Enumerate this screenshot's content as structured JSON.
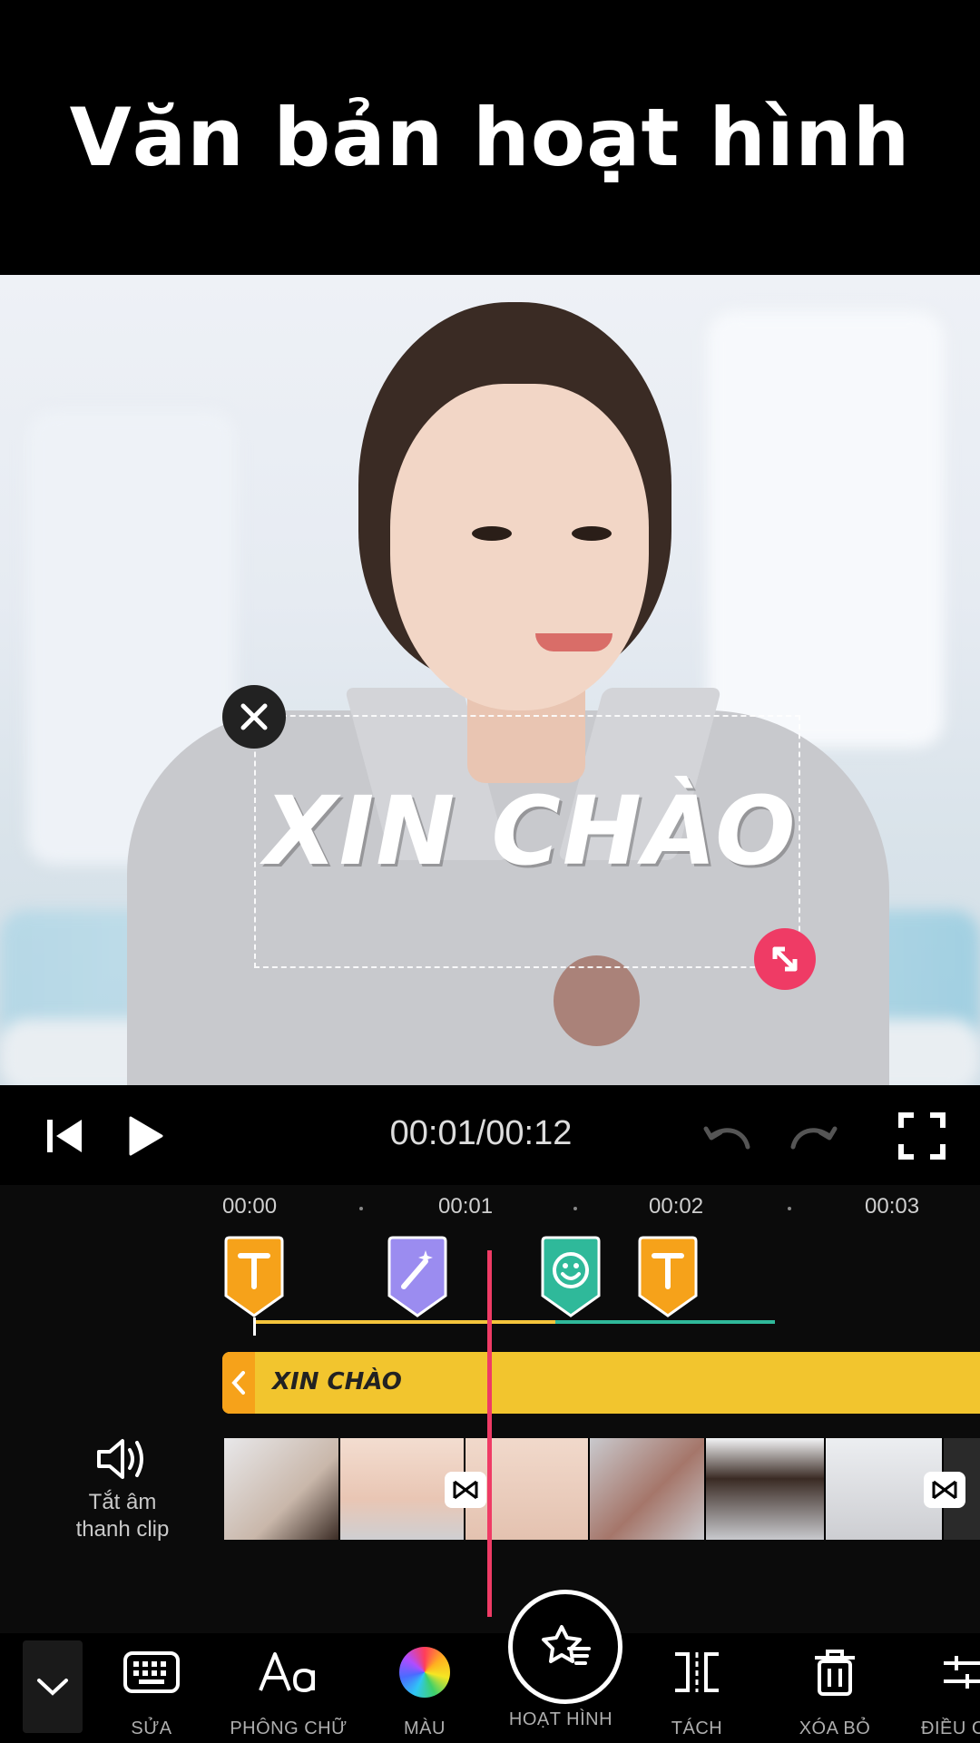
{
  "banner": {
    "title": "Văn bản hoạt hình"
  },
  "preview": {
    "overlay_text": "XIN CHÀO"
  },
  "player": {
    "time": "00:01/00:12"
  },
  "timeline": {
    "ticks": [
      "00:00",
      "00:01",
      "00:02",
      "00:03"
    ],
    "markers": [
      {
        "icon": "text-icon",
        "color": "#f6a21a",
        "letter": "T"
      },
      {
        "icon": "magic-wand-icon",
        "color": "#9b8cf0"
      },
      {
        "icon": "smiley-icon",
        "color": "#2fb99a"
      },
      {
        "icon": "text-icon",
        "color": "#f6a21a",
        "letter": "T"
      }
    ],
    "text_clip_label": "XIN CHÀO",
    "mute": {
      "line1": "Tắt âm",
      "line2": "thanh clip"
    }
  },
  "toolbar": {
    "items": [
      {
        "label": "SỬA",
        "icon": "keyboard-icon"
      },
      {
        "label": "PHÔNG CHỮ",
        "icon": "font-icon"
      },
      {
        "label": "MÀU",
        "icon": "color-wheel-icon"
      },
      {
        "label": "HOẠT HÌNH",
        "icon": "animation-star-icon"
      },
      {
        "label": "TÁCH",
        "icon": "split-icon"
      },
      {
        "label": "XÓA BỎ",
        "icon": "trash-icon"
      },
      {
        "label": "ĐIỀU C",
        "icon": "adjust-icon"
      }
    ]
  },
  "colors": {
    "accent": "#ef3b65",
    "clip_yellow": "#f2c52e",
    "marker_orange": "#f6a21a",
    "marker_purple": "#9b8cf0",
    "marker_green": "#2fb99a"
  }
}
